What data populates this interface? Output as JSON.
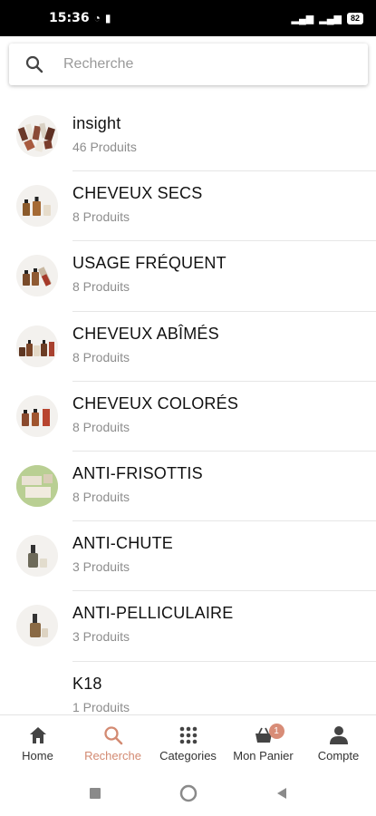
{
  "status_bar": {
    "time": "15:36",
    "battery": "82"
  },
  "search": {
    "placeholder": "Recherche",
    "value": ""
  },
  "categories": [
    {
      "title": "insight",
      "subtitle": "46 Produits",
      "icon": "insight-products-image"
    },
    {
      "title": "CHEVEUX SECS",
      "subtitle": "8 Produits",
      "icon": "dry-hair-products-image"
    },
    {
      "title": "USAGE FRÉQUENT",
      "subtitle": "8 Produits",
      "icon": "frequent-use-products-image"
    },
    {
      "title": "CHEVEUX ABÎMÉS",
      "subtitle": "8 Produits",
      "icon": "damaged-hair-products-image"
    },
    {
      "title": "CHEVEUX COLORÉS",
      "subtitle": "8 Produits",
      "icon": "colored-hair-products-image"
    },
    {
      "title": "ANTI-FRISOTTIS",
      "subtitle": "8 Produits",
      "icon": "anti-frizz-products-image"
    },
    {
      "title": "ANTI-CHUTE",
      "subtitle": "3 Produits",
      "icon": "anti-hairloss-products-image"
    },
    {
      "title": "ANTI-PELLICULAIRE",
      "subtitle": "3 Produits",
      "icon": "anti-dandruff-products-image"
    },
    {
      "title": "K18",
      "subtitle": "1 Produits",
      "icon": "k18-products-image"
    }
  ],
  "bottom_nav": {
    "items": [
      {
        "label": "Home",
        "icon": "home-icon"
      },
      {
        "label": "Recherche",
        "icon": "search-icon",
        "active": true
      },
      {
        "label": "Categories",
        "icon": "grid-icon"
      },
      {
        "label": "Mon Panier",
        "icon": "basket-icon",
        "badge": "1"
      },
      {
        "label": "Compte",
        "icon": "person-icon"
      }
    ]
  },
  "colors": {
    "accent": "#d38a72",
    "badge": "#d88c77",
    "divider": "#e6e6e6",
    "subtitle": "#8d8d8d"
  }
}
